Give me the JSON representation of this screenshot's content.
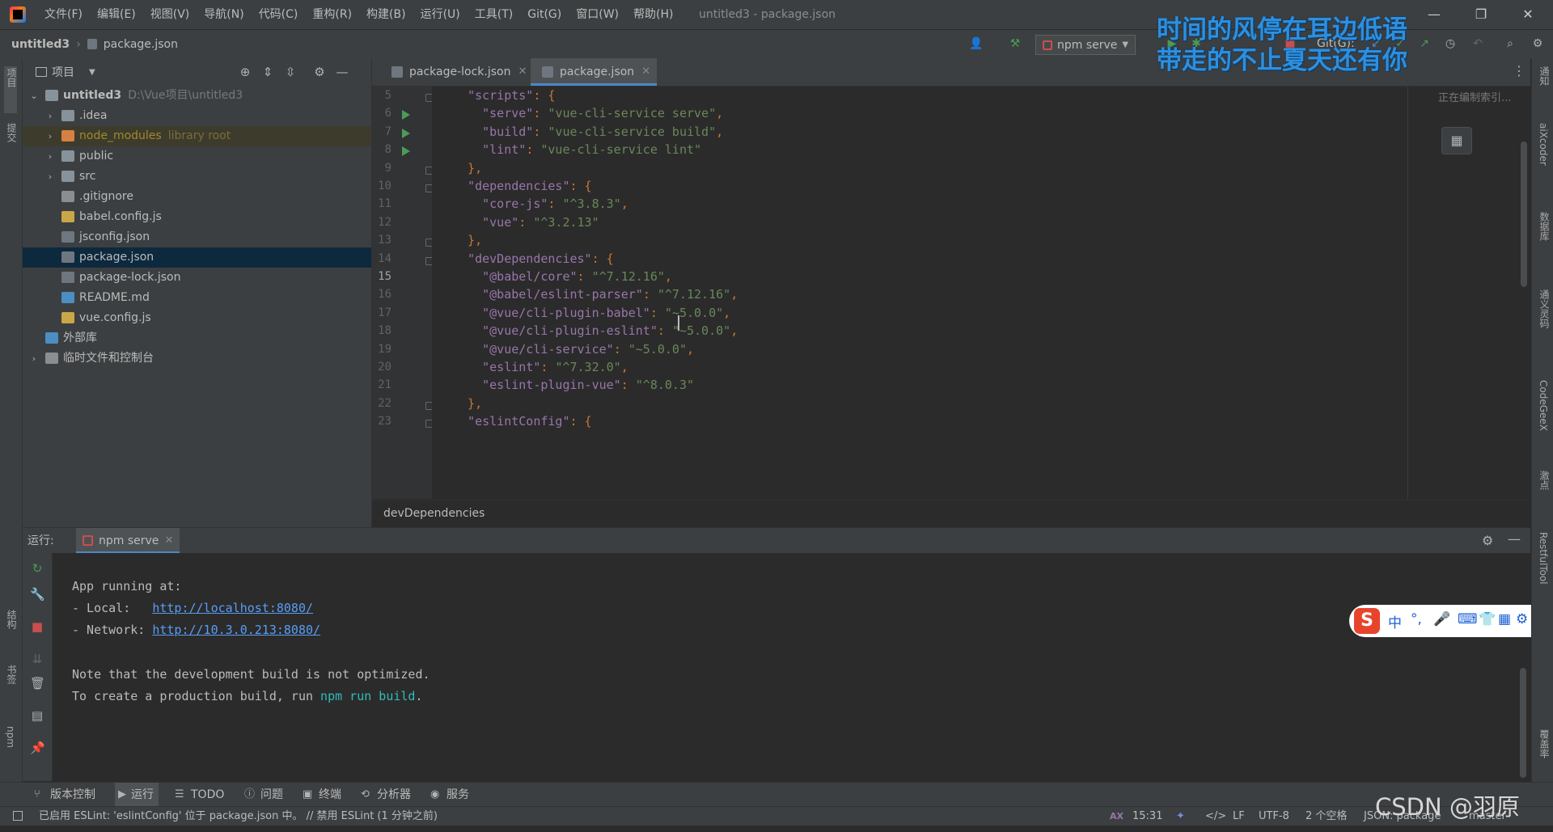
{
  "window": {
    "title": "untitled3 - package.json",
    "menu": [
      "文件(F)",
      "编辑(E)",
      "视图(V)",
      "导航(N)",
      "代码(C)",
      "重构(R)",
      "构建(B)",
      "运行(U)",
      "工具(T)",
      "Git(G)",
      "窗口(W)",
      "帮助(H)"
    ],
    "controls": {
      "minimize": "—",
      "restore": "❐",
      "close": "✕"
    }
  },
  "navbar": {
    "project": "untitled3",
    "file": "package.json",
    "run_config": "npm serve",
    "git_label": "Git(G):"
  },
  "left_stripe": {
    "project": "项目",
    "commit": "提交",
    "structure": "结构",
    "bookmarks": "书签",
    "npm": "npm"
  },
  "right_stripe": {
    "notifications": "通知",
    "aixcoder": "aiXcoder",
    "database": "数据库",
    "tongyi": "通义灵码",
    "codegeex": "CodeGeeX",
    "points": "激点",
    "restful": "RestfulTool",
    "coverage": "覆盖率"
  },
  "project_panel": {
    "title": "项目",
    "tree": [
      {
        "label": "untitled3",
        "hint": "D:\\Vue项目\\untitled3",
        "level": 0,
        "type": "project",
        "arrow": "⌄"
      },
      {
        "label": ".idea",
        "level": 1,
        "type": "folder",
        "arrow": "›"
      },
      {
        "label": "node_modules",
        "hint": "library root",
        "level": 1,
        "type": "folder-excluded",
        "arrow": "›"
      },
      {
        "label": "public",
        "level": 1,
        "type": "folder",
        "arrow": "›"
      },
      {
        "label": "src",
        "level": 1,
        "type": "folder",
        "arrow": "›"
      },
      {
        "label": ".gitignore",
        "level": 1,
        "type": "git"
      },
      {
        "label": "babel.config.js",
        "level": 1,
        "type": "js"
      },
      {
        "label": "jsconfig.json",
        "level": 1,
        "type": "json"
      },
      {
        "label": "package.json",
        "level": 1,
        "type": "json",
        "selected": true
      },
      {
        "label": "package-lock.json",
        "level": 1,
        "type": "json"
      },
      {
        "label": "README.md",
        "level": 1,
        "type": "md"
      },
      {
        "label": "vue.config.js",
        "level": 1,
        "type": "js"
      },
      {
        "label": "外部库",
        "level": 0,
        "type": "lib"
      },
      {
        "label": "临时文件和控制台",
        "level": 0,
        "type": "scratch",
        "arrow": "›"
      }
    ]
  },
  "editor": {
    "tabs": [
      {
        "label": "package-lock.json",
        "active": false
      },
      {
        "label": "package.json",
        "active": true
      }
    ],
    "indexing_text": "正在编制索引...",
    "breadcrumb": "devDependencies",
    "lines": [
      {
        "n": "5",
        "text": "  \"scripts\": {"
      },
      {
        "n": "6",
        "text": "    \"serve\": \"vue-cli-service serve\","
      },
      {
        "n": "7",
        "text": "    \"build\": \"vue-cli-service build\","
      },
      {
        "n": "8",
        "text": "    \"lint\": \"vue-cli-service lint\""
      },
      {
        "n": "9",
        "text": "  },"
      },
      {
        "n": "10",
        "text": "  \"dependencies\": {"
      },
      {
        "n": "11",
        "text": "    \"core-js\": \"^3.8.3\","
      },
      {
        "n": "12",
        "text": "    \"vue\": \"^3.2.13\""
      },
      {
        "n": "13",
        "text": "  },"
      },
      {
        "n": "14",
        "text": "  \"devDependencies\": {"
      },
      {
        "n": "15",
        "text": "    \"@babel/core\": \"^7.12.16\","
      },
      {
        "n": "16",
        "text": "    \"@babel/eslint-parser\": \"^7.12.16\","
      },
      {
        "n": "17",
        "text": "    \"@vue/cli-plugin-babel\": \"~5.0.0\","
      },
      {
        "n": "18",
        "text": "    \"@vue/cli-plugin-eslint\": \"~5.0.0\","
      },
      {
        "n": "19",
        "text": "    \"@vue/cli-service\": \"~5.0.0\","
      },
      {
        "n": "20",
        "text": "    \"eslint\": \"^7.32.0\","
      },
      {
        "n": "21",
        "text": "    \"eslint-plugin-vue\": \"^8.0.3\""
      },
      {
        "n": "22",
        "text": "  },"
      },
      {
        "n": "23",
        "text": "  \"eslintConfig\": {"
      }
    ]
  },
  "run_panel": {
    "label": "运行:",
    "tab": "npm serve",
    "console": {
      "app_running": "App running at:",
      "local_label": "- Local:   ",
      "local_url": "http://localhost:8080/",
      "network_label": "- Network: ",
      "network_url": "http://10.3.0.213:8080/",
      "note": "Note that the development build is not optimized.",
      "prod_prefix": "To create a production build, run ",
      "prod_cmd": "npm run build",
      "prod_suffix": "."
    }
  },
  "bottom_tabs": [
    "版本控制",
    "运行",
    "TODO",
    "问题",
    "终端",
    "分析器",
    "服务"
  ],
  "statusbar": {
    "message": "已启用 ESLint: 'eslintConfig' 位于 package.json 中。 // 禁用 ESLint (1 分钟之前)",
    "position": "15:31",
    "line_sep": "LF",
    "encoding": "UTF-8",
    "indent": "2 个空格",
    "schema": "JSON: package",
    "branch": "master"
  },
  "overlay": {
    "lyrics": [
      "时间的风停在耳边低语",
      "带走的不止夏天还有你"
    ],
    "ime": {
      "logo": "S",
      "mode": "中",
      "punct": "°,",
      "items": [
        "🎤",
        "⌨",
        "👕",
        "▦",
        "⚙"
      ]
    },
    "watermark": "CSDN @羽原"
  }
}
